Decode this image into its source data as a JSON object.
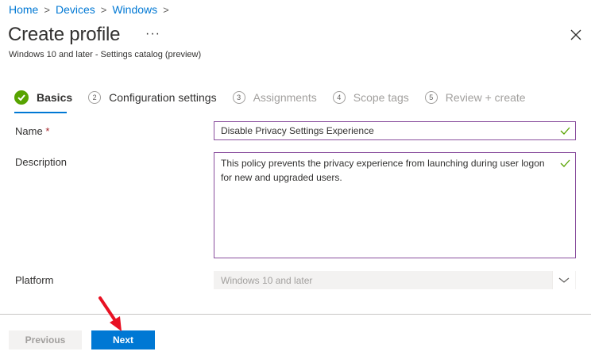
{
  "breadcrumb": [
    "Home",
    "Devices",
    "Windows"
  ],
  "header": {
    "title": "Create profile",
    "more": "···",
    "subtitle": "Windows 10 and later - Settings catalog (preview)"
  },
  "steps": [
    {
      "num": "",
      "label": "Basics",
      "state": "completed"
    },
    {
      "num": "2",
      "label": "Configuration settings",
      "state": "normal"
    },
    {
      "num": "3",
      "label": "Assignments",
      "state": "disabled"
    },
    {
      "num": "4",
      "label": "Scope tags",
      "state": "disabled"
    },
    {
      "num": "5",
      "label": "Review + create",
      "state": "disabled"
    }
  ],
  "form": {
    "name_label": "Name",
    "required_mark": "*",
    "name_value": "Disable Privacy Settings Experience",
    "description_label": "Description",
    "description_value": "This policy prevents the privacy experience from launching during user logon for new and upgraded users.",
    "platform_label": "Platform",
    "platform_value": "Windows 10 and later"
  },
  "footer": {
    "previous_label": "Previous",
    "next_label": "Next"
  },
  "colors": {
    "accent": "#0078d4",
    "success": "#57a300",
    "field_border": "#8a4f9e",
    "annotation_arrow": "#e81123"
  }
}
